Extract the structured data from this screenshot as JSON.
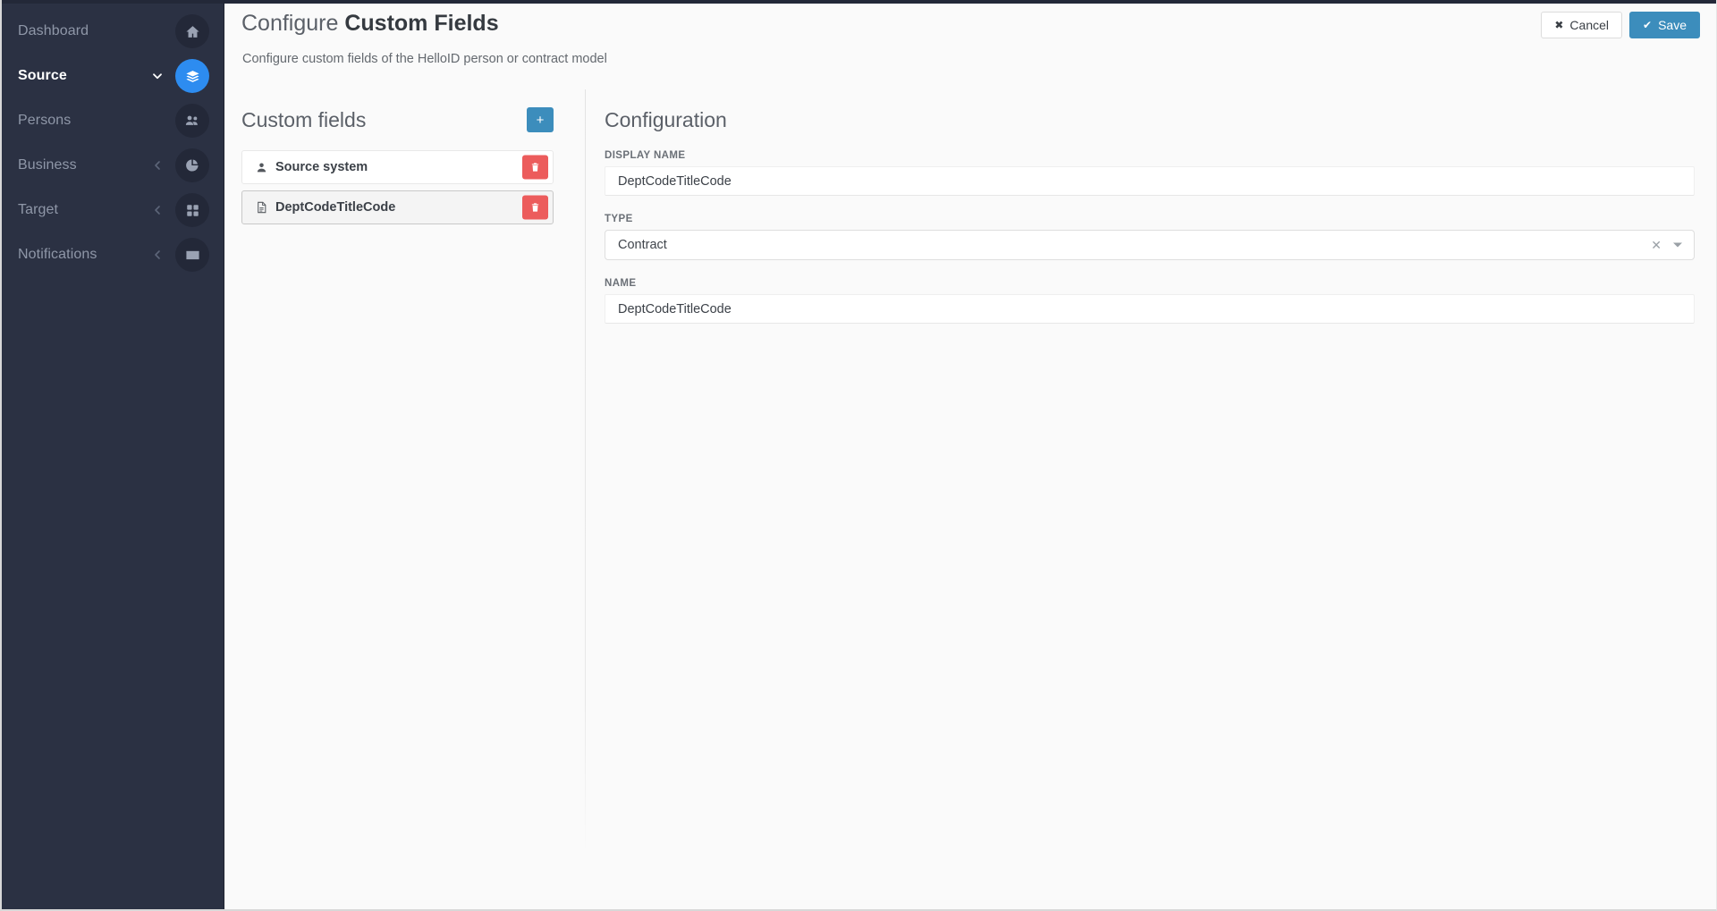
{
  "sidebar": {
    "items": [
      {
        "label": "Dashboard",
        "icon": "home-icon",
        "active": false,
        "chevron": "none"
      },
      {
        "label": "Source",
        "icon": "layers-icon",
        "active": true,
        "chevron": "down"
      },
      {
        "label": "Persons",
        "icon": "users-icon",
        "active": false,
        "chevron": "none"
      },
      {
        "label": "Business",
        "icon": "pie-chart-icon",
        "active": false,
        "chevron": "left"
      },
      {
        "label": "Target",
        "icon": "grid-icon",
        "active": false,
        "chevron": "left"
      },
      {
        "label": "Notifications",
        "icon": "envelope-icon",
        "active": false,
        "chevron": "left"
      }
    ]
  },
  "header": {
    "title_prefix": "Configure ",
    "title_strong": "Custom Fields",
    "subtitle": "Configure custom fields of the HelloID person or contract model",
    "cancel_label": "Cancel",
    "cancel_icon": "close-icon",
    "save_label": "Save",
    "save_icon": "check-icon"
  },
  "custom_fields": {
    "title": "Custom fields",
    "add_label": "+",
    "add_icon": "plus-icon",
    "delete_icon": "trash-icon",
    "items": [
      {
        "label": "Source system",
        "icon": "person-icon",
        "selected": false
      },
      {
        "label": "DeptCodeTitleCode",
        "icon": "document-icon",
        "selected": true
      }
    ]
  },
  "configuration": {
    "title": "Configuration",
    "display_name": {
      "label": "DISPLAY NAME",
      "value": "DeptCodeTitleCode",
      "placeholder": ""
    },
    "type": {
      "label": "TYPE",
      "value": "Contract",
      "clear_icon": "close-icon",
      "caret_icon": "chevron-down-icon"
    },
    "name": {
      "label": "NAME",
      "value": "DeptCodeTitleCode",
      "placeholder": ""
    }
  },
  "colors": {
    "sidebar_bg": "#2b3143",
    "accent_blue": "#2d8cf0",
    "button_blue": "#3c8dbc",
    "danger_red": "#ec5c5c",
    "page_bg": "#fafafa"
  }
}
